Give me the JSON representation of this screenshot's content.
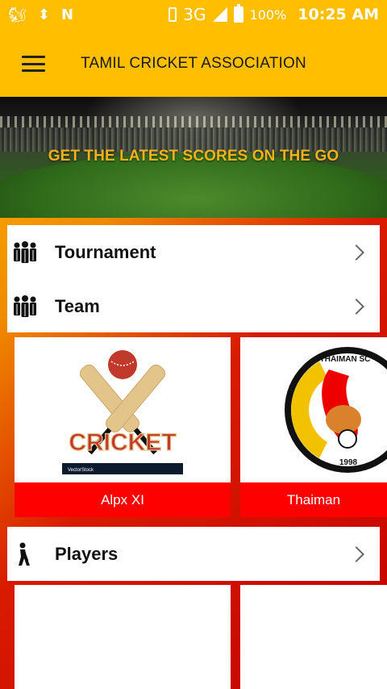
{
  "status_bar": {
    "network": "3G",
    "network_sup": "3G",
    "battery": "100%",
    "time": "10:25 AM"
  },
  "app_bar": {
    "title": "TAMIL CRICKET ASSOCIATION"
  },
  "banner": {
    "tagline": "GET THE LATEST SCORES ON THE GO"
  },
  "menu": {
    "items": [
      {
        "label": "Tournament",
        "icon": "group-icon"
      },
      {
        "label": "Team",
        "icon": "group-icon"
      }
    ],
    "players": {
      "label": "Players",
      "icon": "batsman-icon"
    }
  },
  "teams": [
    {
      "name": "Alpx XI",
      "logo": "cricket-logo",
      "logo_text": "CRICKET",
      "logo_footer": "VectorStock"
    },
    {
      "name": "Thaiman",
      "logo": "thaiman-sc-logo",
      "logo_text": "THAIMAN SC",
      "logo_year": "1998"
    }
  ],
  "colors": {
    "accent": "#ffbf00",
    "team_bar": "#ff0000"
  }
}
